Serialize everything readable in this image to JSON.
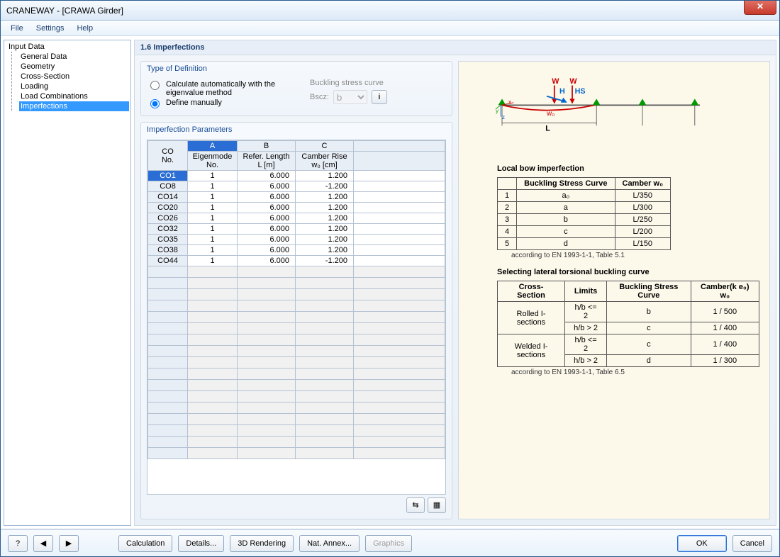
{
  "window": {
    "title": "CRANEWAY - [CRAWA Girder]"
  },
  "menubar": {
    "file": "File",
    "settings": "Settings",
    "help": "Help"
  },
  "tree": {
    "root": "Input Data",
    "items": [
      "General Data",
      "Geometry",
      "Cross-Section",
      "Loading",
      "Load Combinations",
      "Imperfections"
    ],
    "selectedIndex": 5
  },
  "panel": {
    "title": "1.6  Imperfections"
  },
  "definition": {
    "group": "Type of Definition",
    "opt_auto": "Calculate automatically with the eigenvalue method",
    "opt_manual": "Define manually",
    "buckling_label": "Buckling stress curve",
    "bsc_label": "Bscz:",
    "bsc_value": "b",
    "info_icon": "i"
  },
  "imp": {
    "group": "Imperfection Parameters",
    "letters": [
      "A",
      "B",
      "C"
    ],
    "head_co1": "CO",
    "head_co2": "No.",
    "head_a1": "Eigenmode",
    "head_a2": "No.",
    "head_b1": "Refer. Length",
    "head_b2": "L [m]",
    "head_c1": "Camber Rise",
    "head_c2": "w₀ [cm]",
    "rows": [
      {
        "co": "CO1",
        "a": "1",
        "b": "6.000",
        "c": "1.200"
      },
      {
        "co": "CO8",
        "a": "1",
        "b": "6.000",
        "c": "-1.200"
      },
      {
        "co": "CO14",
        "a": "1",
        "b": "6.000",
        "c": "1.200"
      },
      {
        "co": "CO20",
        "a": "1",
        "b": "6.000",
        "c": "1.200"
      },
      {
        "co": "CO26",
        "a": "1",
        "b": "6.000",
        "c": "1.200"
      },
      {
        "co": "CO32",
        "a": "1",
        "b": "6.000",
        "c": "1.200"
      },
      {
        "co": "CO35",
        "a": "1",
        "b": "6.000",
        "c": "1.200"
      },
      {
        "co": "CO38",
        "a": "1",
        "b": "6.000",
        "c": "1.200"
      },
      {
        "co": "CO44",
        "a": "1",
        "b": "6.000",
        "c": "-1.200"
      }
    ],
    "icon_swap": "⇆",
    "icon_calc": "▦"
  },
  "info": {
    "diag_labels": {
      "W": "W",
      "H": "H",
      "HS": "HS",
      "w0": "w₀",
      "L": "L",
      "x": "x",
      "y": "y",
      "z": "z"
    },
    "bow_title": "Local bow imperfection",
    "bow_head1": "Buckling Stress Curve",
    "bow_head2": "Camber w₀",
    "bow_rows": [
      {
        "n": "1",
        "c": "a₀",
        "w": "L/350"
      },
      {
        "n": "2",
        "c": "a",
        "w": "L/300"
      },
      {
        "n": "3",
        "c": "b",
        "w": "L/250"
      },
      {
        "n": "4",
        "c": "c",
        "w": "L/200"
      },
      {
        "n": "5",
        "c": "d",
        "w": "L/150"
      }
    ],
    "bow_note": "according to EN 1993-1-1, Table 5.1",
    "ltb_title": "Selecting lateral torsional buckling curve",
    "ltb_head1": "Cross-Section",
    "ltb_head2": "Limits",
    "ltb_head3": "Buckling Stress Curve",
    "ltb_head4": "Camber(k e₀) w₀",
    "ltb_rows": [
      {
        "cs": "Rolled I-sections",
        "lim": "h/b <= 2",
        "curve": "b",
        "cam": "1 / 500"
      },
      {
        "cs": "",
        "lim": "h/b > 2",
        "curve": "c",
        "cam": "1 / 400"
      },
      {
        "cs": "Welded I-sections",
        "lim": "h/b <= 2",
        "curve": "c",
        "cam": "1 / 400"
      },
      {
        "cs": "",
        "lim": "h/b > 2",
        "curve": "d",
        "cam": "1 / 300"
      }
    ],
    "ltb_note": "according to EN 1993-1-1, Table 6.5"
  },
  "footer": {
    "help": "?",
    "prev": "◀",
    "next": "▶",
    "calculation": "Calculation",
    "details": "Details...",
    "rendering": "3D Rendering",
    "annex": "Nat. Annex...",
    "graphics": "Graphics",
    "ok": "OK",
    "cancel": "Cancel"
  }
}
